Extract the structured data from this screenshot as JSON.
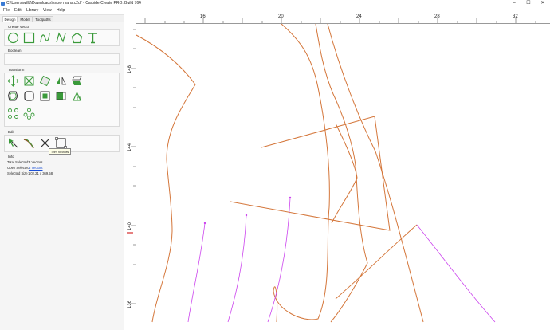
{
  "window": {
    "title": "C:\\Users\\willd\\Downloads\\snow mans.c2d* - Carbide Create PRO: Build 764",
    "controls": [
      "–",
      "☐",
      "✕"
    ]
  },
  "menu": [
    "File",
    "Edit",
    "Library",
    "View",
    "Help"
  ],
  "panel_tabs": [
    "Design",
    "Model",
    "Toolpaths"
  ],
  "sections": {
    "create_vector": "Create Vector",
    "boolean": "Boolean",
    "transform": "Transform",
    "edit": "Edit",
    "info": "Info"
  },
  "icons": {
    "create": [
      "circle-icon",
      "rectangle-icon",
      "curve-icon",
      "polyline-icon",
      "polygon-icon",
      "text-icon"
    ],
    "transform": [
      "move-icon",
      "scale-icon",
      "rotate-icon",
      "mirror-icon",
      "skew-icon",
      "offset-icon",
      "fillet-icon",
      "align-icon",
      "trace-image-icon",
      "circular-array-icon",
      "linear-array-icon"
    ],
    "edit": [
      "node-edit-icon",
      "join-icon",
      "trim-icon",
      "trim-vectors-icon"
    ]
  },
  "tooltip": "Trim Vectors",
  "info": {
    "total_selected_label": "Total Selected:",
    "total_selected_value": "3 Vectors",
    "open_selected_label": "Open Selected:",
    "open_selected_value": "3 Vectors",
    "selected_size_label": "Selected Size:",
    "selected_size_value": "102.21 x 369.58"
  },
  "ruler": {
    "x_ticks": [
      "16",
      "20",
      "24",
      "28",
      "32"
    ],
    "y_ticks": [
      "148",
      "144",
      "140",
      "136"
    ]
  },
  "colors": {
    "vector": "#d4763a",
    "selected": "#cc44ee",
    "icon_green": "#3a9a3a",
    "link": "#1a4fd6"
  }
}
